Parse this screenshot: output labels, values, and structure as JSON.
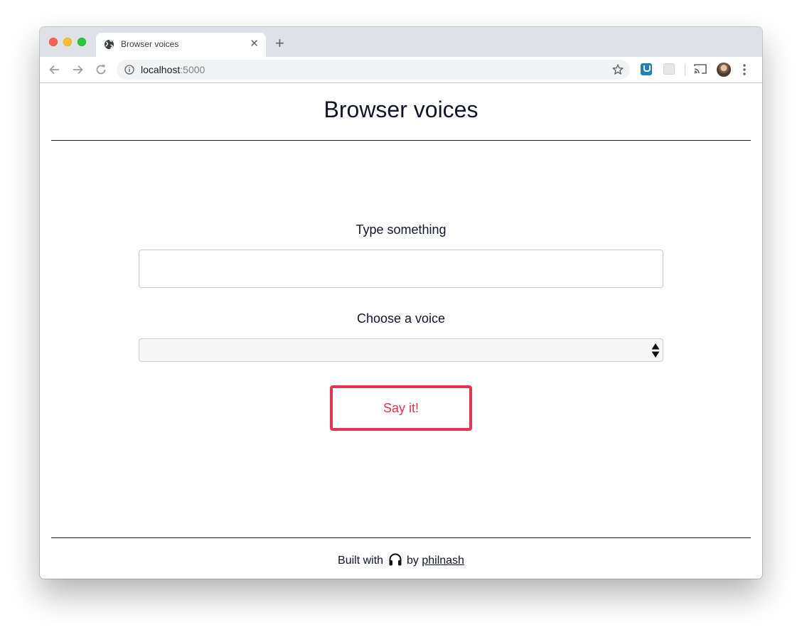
{
  "browser": {
    "tab_title": "Browser voices",
    "url_host": "localhost",
    "url_port": ":5000"
  },
  "page": {
    "title": "Browser voices",
    "text_label": "Type something",
    "text_value": "",
    "voice_label": "Choose a voice",
    "voice_selected": "",
    "button_label": "Say it!",
    "footer_built_with": "Built with",
    "footer_by": "by",
    "footer_author": "philnash"
  },
  "colors": {
    "accent": "#e4344f",
    "text": "#10152a"
  },
  "icons": {
    "favicon": "globe-icon",
    "footer": "headphones-icon"
  }
}
